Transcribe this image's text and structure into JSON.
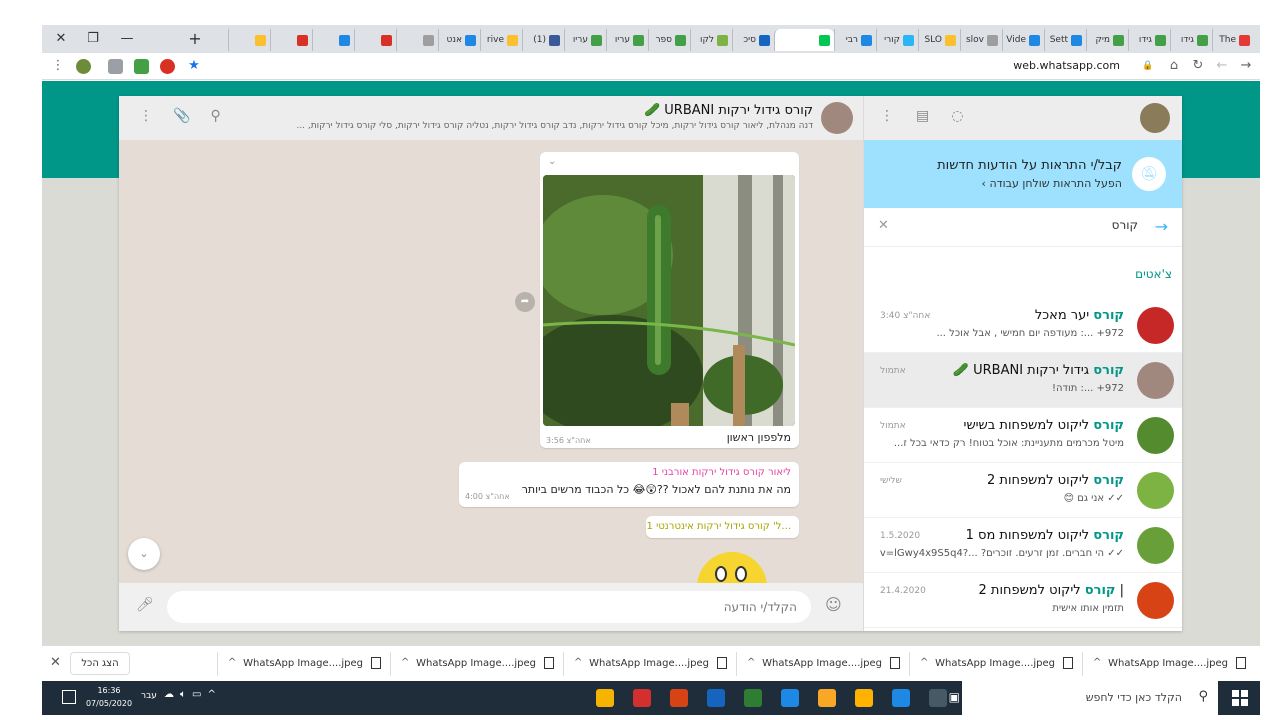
{
  "browser": {
    "tabs": [
      {
        "label": "The",
        "color": "#e53935"
      },
      {
        "label": "גידו",
        "color": "#43a047"
      },
      {
        "label": "גידו",
        "color": "#43a047"
      },
      {
        "label": "מיק",
        "color": "#43a047"
      },
      {
        "label": "Sett",
        "color": "#1e88e5"
      },
      {
        "label": "Vide",
        "color": "#1e88e5"
      },
      {
        "label": "slov",
        "color": "#9e9e9e"
      },
      {
        "label": "SLO",
        "color": "#fbc02d"
      },
      {
        "label": "קורי",
        "color": "#29b6f6"
      },
      {
        "label": "רבי",
        "color": "#1e88e5"
      },
      {
        "label": "",
        "color": "#00c853",
        "active": true
      },
      {
        "label": "סיכ",
        "color": "#1565c0"
      },
      {
        "label": "לקו",
        "color": "#7cb342"
      },
      {
        "label": "ספר",
        "color": "#43a047"
      },
      {
        "label": "עריו",
        "color": "#43a047"
      },
      {
        "label": "עריו",
        "color": "#43a047"
      },
      {
        "label": "(1)",
        "color": "#3b5998"
      },
      {
        "label": "rive",
        "color": "#fbc02d"
      },
      {
        "label": "אנט",
        "color": "#1e88e5"
      },
      {
        "label": "",
        "color": "#9e9e9e"
      },
      {
        "label": "",
        "color": "#d93025"
      },
      {
        "label": "",
        "color": "#1e88e5"
      },
      {
        "label": "",
        "color": "#d93025"
      },
      {
        "label": "",
        "color": "#fbc02d"
      }
    ],
    "url": "web.whatsapp.com",
    "new_tab": "+",
    "minimize": "—",
    "restore": "❐",
    "close": "✕"
  },
  "sidebar": {
    "notification": {
      "title": "קבל/י התראות על הודעות חדשות",
      "subtitle": "הפעל התראות שולחן עבודה ›"
    },
    "search_value": "קורס",
    "chats_label": "צ'אטים",
    "chats": [
      {
        "hl": "קורס",
        "rest": " יער מאכל",
        "time": "3:40 אחה\"צ",
        "preview": "‎+972 ...: מעודפה יום חמישי , אבל אוכל ...",
        "avatar": "#c62828"
      },
      {
        "hl": "קורס",
        "rest": " גידול ירקות URBANI 🥒",
        "time": "אתמול",
        "preview": "‎+972 ...: תודה!",
        "avatar": "#a1887f",
        "selected": true
      },
      {
        "hl": "קורס",
        "rest": " ליקוט למשפחות בשישי",
        "time": "אתמול",
        "preview": "מיטל מכרמים מתעניינת: אוכל בטוח! רק כדאי בכל ז...",
        "avatar": "#558b2f"
      },
      {
        "hl": "קורס",
        "rest": " ליקוט למשפחות 2",
        "time": "שלישי",
        "preview": "✓✓ אני גם 😊",
        "avatar": "#7cb342"
      },
      {
        "hl": "קורס",
        "rest": " ליקוט למשפחות מס 1",
        "time": "1.5.2020",
        "preview": "✓✓ הי חברים. זמן זרעים. זוכרים? ...?v=lGwy4x9S5q4",
        "avatar": "#689f38"
      },
      {
        "pre": "| ",
        "hl": "קורס",
        "rest": " ליקוט למשפחות 2",
        "time": "21.4.2020",
        "preview": "תזמין אותו אישית",
        "avatar": "#d84315"
      }
    ]
  },
  "conversation": {
    "title": "קורס גידול ירקות URBANI 🥒",
    "members": "דנה מנהלת, ליאור קורס גידול ירקות, מיכל קורס גידול ירקות, נדב קורס גידול ירקות, נטליה קורס גידול ירקות, סלי קורס גידול ירקות, ...",
    "image_caption": "מלפפון ראשון",
    "image_time": "3:56 אחה\"צ",
    "msg2_sender": "ליאור קורס גידול ירקות אורבני 1",
    "msg2_text": "מה את נותנת להם לאכול ??😲😂 כל הכבוד מרשים ביותר",
    "msg2_time": "4:00 אחה\"צ",
    "msg3_sender": "...ל' קורס גידול ירקות אינטרנטי 1",
    "input_placeholder": "הקלד/י הודעה"
  },
  "downloads": {
    "show_all": "הצג הכל",
    "files": [
      "WhatsApp Image....jpeg",
      "WhatsApp Image....jpeg",
      "WhatsApp Image....jpeg",
      "WhatsApp Image....jpeg",
      "WhatsApp Image....jpeg",
      "WhatsApp Image....jpeg"
    ]
  },
  "taskbar": {
    "search_placeholder": "הקלד כאן כדי לחפש",
    "time": "16:36",
    "date": "07/05/2020",
    "language": "עבר",
    "apps": [
      "#f4b400",
      "#d32f2f",
      "#d84315",
      "#1565c0",
      "#2e7d32",
      "#1e88e5",
      "#f9a825",
      "#ffb300",
      "#1e88e5",
      "#455a64"
    ]
  }
}
